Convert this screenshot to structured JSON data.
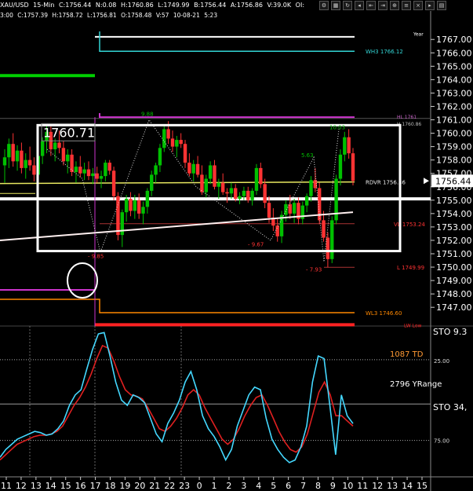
{
  "header": {
    "symbol": "XAU/USD",
    "interval": "15-Min",
    "close": "C:1756.44",
    "net": "N:0.08",
    "high": "H:1760.86",
    "low": "L:1749.99",
    "bid": "B:1756.44",
    "ask": "A:1756.86",
    "volume": "V:39.0K",
    "oi": "OI:",
    "row2_time": "3:00",
    "row2_close": "C:1757.39",
    "row2_high": "H:1758.72",
    "row2_low": "L:1756.81",
    "row2_o": "O:1758.48",
    "row2_volume": "V:57",
    "row2_date": "10-08-21",
    "row2_clock": "5:23"
  },
  "toolbar_icons": [
    "settings-icon",
    "table-icon",
    "refresh-icon",
    "back-icon",
    "compress-icon",
    "expand-icon",
    "zoom-icon",
    "menu-icon",
    "close-icon",
    "scroll-icon",
    "grid-icon"
  ],
  "colors": {
    "background": "#000000",
    "up_candle": "#00c000",
    "down_candle": "#ff3333",
    "cyan": "#33d6d6",
    "yellow": "#e8e860",
    "magenta": "#cc33cc",
    "red": "#ff2222",
    "orange": "#ff8800",
    "green": "#00d000",
    "white": "#ffffff",
    "stoch_k": "#44d8ff",
    "stoch_d": "#e02020",
    "td_text": "#ff9933"
  },
  "chart_data": {
    "type": "candlestick",
    "ylim": [
      1745.3,
      1768.6
    ],
    "price_ticks": [
      "1767.00",
      "1766.00",
      "1765.00",
      "1764.00",
      "1763.00",
      "1762.00",
      "1761.00",
      "1760.00",
      "1759.00",
      "1758.00",
      "1757.00",
      "1756.00",
      "1755.00",
      "1754.00",
      "1753.00",
      "1752.00",
      "1751.00",
      "1750.00",
      "1749.00",
      "1748.00",
      "1747.00"
    ],
    "last_price": "1756.44",
    "x_ticks": [
      "11",
      "12",
      "13",
      "14",
      "15",
      "16",
      "17",
      "18",
      "19",
      "20",
      "21",
      "22",
      "23",
      "0",
      "1",
      "2",
      "3",
      "4",
      "5",
      "6",
      "7",
      "8",
      "9",
      "10",
      "11",
      "12",
      "13",
      "14",
      "15"
    ],
    "candles": [
      [
        1757.6,
        1758.8,
        1756.3,
        1758.2
      ],
      [
        1758.2,
        1759.6,
        1757.4,
        1759.2
      ],
      [
        1759.2,
        1760.0,
        1757.5,
        1757.9
      ],
      [
        1757.9,
        1759.1,
        1757.2,
        1758.7
      ],
      [
        1758.7,
        1759.3,
        1757.0,
        1757.4
      ],
      [
        1757.4,
        1758.5,
        1756.6,
        1758.0
      ],
      [
        1758.0,
        1759.0,
        1757.2,
        1757.6
      ],
      [
        1757.6,
        1758.2,
        1756.4,
        1756.9
      ],
      [
        1756.9,
        1758.6,
        1756.5,
        1758.3
      ],
      [
        1758.3,
        1759.7,
        1757.7,
        1759.4
      ],
      [
        1759.4,
        1760.5,
        1758.5,
        1760.1
      ],
      [
        1760.1,
        1760.5,
        1758.3,
        1758.8
      ],
      [
        1758.8,
        1759.6,
        1757.9,
        1759.3
      ],
      [
        1759.3,
        1760.2,
        1758.5,
        1758.9
      ],
      [
        1758.9,
        1759.4,
        1757.6,
        1757.9
      ],
      [
        1757.9,
        1758.8,
        1757.0,
        1758.4
      ],
      [
        1758.4,
        1758.8,
        1756.8,
        1757.1
      ],
      [
        1757.1,
        1757.9,
        1756.3,
        1757.5
      ],
      [
        1757.5,
        1758.3,
        1756.7,
        1757.0
      ],
      [
        1757.0,
        1757.8,
        1756.5,
        1757.3
      ],
      [
        1757.3,
        1757.9,
        1756.5,
        1756.8
      ],
      [
        1756.8,
        1757.4,
        1756.2,
        1757.0
      ],
      [
        1757.0,
        1757.5,
        1756.3,
        1756.6
      ],
      [
        1756.6,
        1757.2,
        1755.9,
        1756.8
      ],
      [
        1756.8,
        1758.0,
        1756.4,
        1757.8
      ],
      [
        1757.8,
        1758.0,
        1756.9,
        1757.2
      ],
      [
        1757.2,
        1757.5,
        1755.0,
        1755.3
      ],
      [
        1755.3,
        1755.6,
        1752.0,
        1752.4
      ],
      [
        1752.4,
        1754.3,
        1751.5,
        1754.1
      ],
      [
        1754.1,
        1755.4,
        1753.4,
        1755.1
      ],
      [
        1755.1,
        1755.6,
        1753.8,
        1754.2
      ],
      [
        1754.2,
        1755.4,
        1753.6,
        1755.0
      ],
      [
        1755.0,
        1755.5,
        1753.6,
        1754.0
      ],
      [
        1754.0,
        1754.9,
        1753.2,
        1754.5
      ],
      [
        1754.5,
        1755.9,
        1754.0,
        1755.7
      ],
      [
        1755.7,
        1757.2,
        1755.3,
        1756.9
      ],
      [
        1756.9,
        1757.8,
        1756.3,
        1757.6
      ],
      [
        1757.6,
        1759.2,
        1757.1,
        1758.9
      ],
      [
        1758.9,
        1760.6,
        1758.6,
        1760.3
      ],
      [
        1760.3,
        1760.9,
        1759.2,
        1759.6
      ],
      [
        1759.6,
        1760.2,
        1758.6,
        1759.0
      ],
      [
        1759.0,
        1759.8,
        1758.2,
        1759.5
      ],
      [
        1759.5,
        1760.0,
        1758.9,
        1759.2
      ],
      [
        1759.2,
        1759.5,
        1757.4,
        1757.8
      ],
      [
        1757.8,
        1758.5,
        1756.8,
        1757.0
      ],
      [
        1757.0,
        1758.0,
        1756.4,
        1757.7
      ],
      [
        1757.7,
        1758.3,
        1756.7,
        1756.9
      ],
      [
        1756.9,
        1757.6,
        1755.4,
        1755.6
      ],
      [
        1755.6,
        1756.9,
        1755.2,
        1756.6
      ],
      [
        1756.6,
        1757.9,
        1756.2,
        1757.6
      ],
      [
        1757.6,
        1758.0,
        1755.8,
        1756.0
      ],
      [
        1756.0,
        1756.6,
        1755.1,
        1756.3
      ],
      [
        1756.3,
        1757.0,
        1755.4,
        1755.6
      ],
      [
        1755.6,
        1755.9,
        1754.8,
        1755.5
      ],
      [
        1755.5,
        1756.3,
        1755.1,
        1755.9
      ],
      [
        1755.9,
        1756.2,
        1754.9,
        1755.1
      ],
      [
        1755.1,
        1755.6,
        1754.7,
        1755.3
      ],
      [
        1755.3,
        1756.0,
        1755.0,
        1755.7
      ],
      [
        1755.7,
        1756.0,
        1754.8,
        1755.0
      ],
      [
        1755.0,
        1755.9,
        1754.6,
        1755.7
      ],
      [
        1755.7,
        1757.7,
        1755.4,
        1757.4
      ],
      [
        1757.4,
        1757.8,
        1755.9,
        1756.2
      ],
      [
        1756.2,
        1756.6,
        1754.4,
        1754.8
      ],
      [
        1754.8,
        1755.3,
        1753.3,
        1753.7
      ],
      [
        1753.7,
        1754.4,
        1752.7,
        1753.1
      ],
      [
        1753.1,
        1753.6,
        1751.9,
        1752.3
      ],
      [
        1752.3,
        1754.2,
        1751.8,
        1753.9
      ],
      [
        1753.9,
        1755.0,
        1753.4,
        1754.7
      ],
      [
        1754.7,
        1755.4,
        1753.6,
        1754.0
      ],
      [
        1754.0,
        1755.1,
        1753.3,
        1754.8
      ],
      [
        1754.8,
        1755.2,
        1753.2,
        1753.6
      ],
      [
        1753.6,
        1754.9,
        1753.2,
        1754.6
      ],
      [
        1754.6,
        1755.5,
        1754.1,
        1755.3
      ],
      [
        1755.3,
        1756.8,
        1754.9,
        1756.5
      ],
      [
        1756.5,
        1757.4,
        1755.6,
        1755.9
      ],
      [
        1755.9,
        1756.3,
        1753.2,
        1753.5
      ],
      [
        1753.5,
        1754.2,
        1751.9,
        1752.2
      ],
      [
        1752.2,
        1752.6,
        1749.99,
        1750.6
      ],
      [
        1750.6,
        1753.8,
        1750.3,
        1753.5
      ],
      [
        1753.5,
        1756.9,
        1753.2,
        1756.6
      ],
      [
        1756.6,
        1758.8,
        1756.1,
        1758.4
      ],
      [
        1758.4,
        1760.1,
        1757.9,
        1759.7
      ],
      [
        1759.7,
        1760.3,
        1758.1,
        1758.5
      ],
      [
        1758.5,
        1758.9,
        1756.1,
        1756.44
      ]
    ],
    "levels": [
      {
        "label": "",
        "price": 1767.2,
        "color": "#ffffff"
      },
      {
        "label": "WH3 1766.12",
        "price": 1766.12,
        "color": "#33d6d6"
      },
      {
        "label": "RDVR 1756.36",
        "price": 1756.36,
        "color": "#e8e860"
      },
      {
        "label": "VL 1753.24",
        "price": 1753.24,
        "color": "#ff3333"
      },
      {
        "label": "L 1749.99",
        "price": 1749.99,
        "color": "#ff3333"
      },
      {
        "label": "WL3 1746.60",
        "price": 1746.6,
        "color": "#ff8800"
      },
      {
        "label": "LW Low",
        "price": 1745.5,
        "color": "#ff2222"
      }
    ],
    "annotations": [
      {
        "text": "Year",
        "price": 1767.4
      },
      {
        "text": "9.88",
        "price": 1761.3
      },
      {
        "text": "10.03",
        "price": 1760.3
      },
      {
        "text": "5.63",
        "price": 1758.2
      },
      {
        "text": "- 9.67",
        "price": 1751.8
      },
      {
        "text": "- 7.93",
        "price": 1749.9
      },
      {
        "text": "- 9.85",
        "price": 1750.9
      },
      {
        "text": "HL 1761",
        "price": 1761.2
      },
      {
        "text": "H 1760.86",
        "price": 1760.86
      }
    ],
    "box_label": "1760.71",
    "box_range": [
      1751.2,
      1760.6
    ],
    "indicator": {
      "name": "STO",
      "params": "34,",
      "top_label": "STO 9.3",
      "levels": [
        "25.00",
        "75.00"
      ],
      "td_text": "1087 TD",
      "yrange_text": "2796 YRange",
      "k": [
        88,
        82,
        78,
        74,
        72,
        70,
        68,
        69,
        71,
        70,
        66,
        60,
        48,
        40,
        36,
        20,
        5,
        -7,
        -8,
        10,
        30,
        44,
        48,
        40,
        42,
        46,
        58,
        70,
        76,
        62,
        54,
        44,
        30,
        22,
        36,
        56,
        66,
        72,
        80,
        90,
        82,
        64,
        52,
        40,
        34,
        36,
        58,
        74,
        82,
        88,
        92,
        90,
        80,
        64,
        30,
        10,
        12,
        48,
        86,
        40,
        56,
        62
      ],
      "d": [
        90,
        86,
        82,
        78,
        76,
        74,
        72,
        71,
        71,
        70,
        68,
        64,
        56,
        48,
        42,
        34,
        24,
        12,
        2,
        4,
        14,
        26,
        36,
        40,
        41,
        43,
        50,
        58,
        66,
        68,
        64,
        58,
        50,
        40,
        36,
        40,
        50,
        58,
        66,
        74,
        78,
        74,
        66,
        56,
        48,
        42,
        40,
        48,
        58,
        68,
        76,
        82,
        84,
        80,
        70,
        54,
        38,
        30,
        40,
        56,
        56,
        60,
        64
      ]
    }
  }
}
